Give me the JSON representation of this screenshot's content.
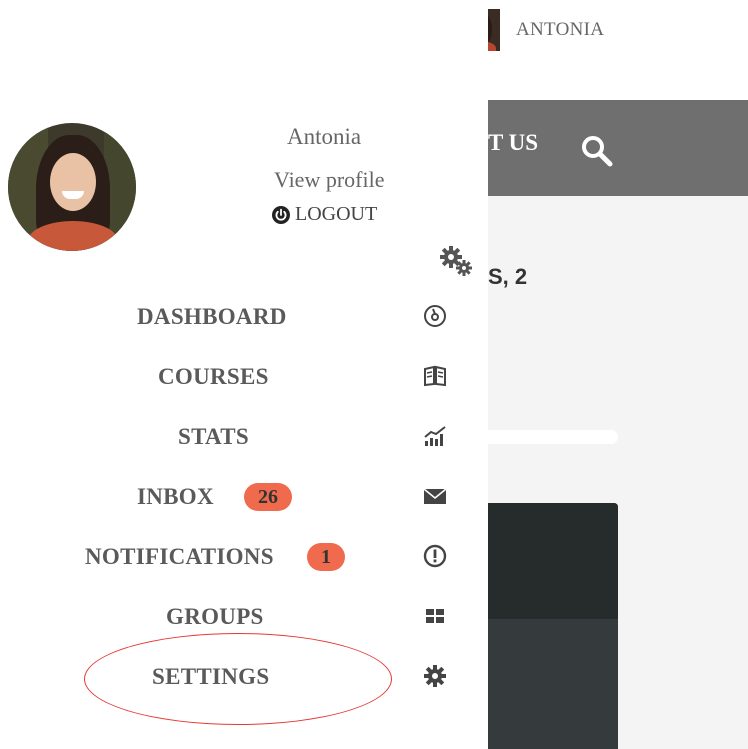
{
  "topbar": {
    "username": "ANTONIA"
  },
  "background_page": {
    "nav_label": "T US",
    "heading": "S, 2"
  },
  "profile": {
    "name": "Antonia",
    "view_profile": "View profile",
    "logout": "LOGOUT"
  },
  "menu": {
    "items": [
      {
        "label": "DASHBOARD",
        "icon": "dashboard-icon"
      },
      {
        "label": "COURSES",
        "icon": "book-icon"
      },
      {
        "label": "STATS",
        "icon": "chart-icon"
      },
      {
        "label": "INBOX",
        "icon": "envelope-icon",
        "badge": "26"
      },
      {
        "label": "NOTIFICATIONS",
        "icon": "alert-icon",
        "badge": "1"
      },
      {
        "label": "GROUPS",
        "icon": "groups-icon"
      },
      {
        "label": "SETTINGS",
        "icon": "gear-icon"
      }
    ]
  },
  "colors": {
    "badge": "#f06b4d",
    "highlight_ring": "#e53935",
    "online": "#4caf50",
    "nav_bar": "#6f6f6f"
  }
}
